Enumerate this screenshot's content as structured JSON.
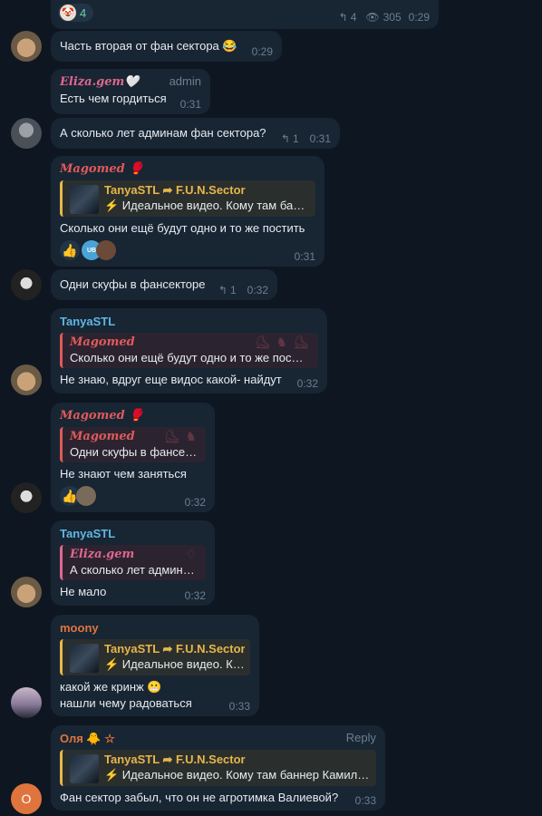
{
  "colors": {
    "background": "#0e1621",
    "bubble": "#182533",
    "eliza": "#e0678f",
    "magomed": "#e05a5a",
    "tanya": "#5fb7e3",
    "moony": "#e0743d",
    "olya": "#e0743d",
    "forward_name": "#e8b64a",
    "meta": "#6d7f8f"
  },
  "top_fragment": {
    "reaction_count": "4",
    "replies": "4",
    "views": "305",
    "time": "0:29"
  },
  "messages": [
    {
      "id": "m1",
      "text": "Часть вторая от фан сектора 😂",
      "time": "0:29"
    },
    {
      "id": "m2",
      "author": "Eliza.gem🤍",
      "role": "admin",
      "text": "Есть чем гордиться",
      "time": "0:31"
    },
    {
      "id": "m3",
      "text": "А сколько лет админам фан сектора?",
      "replies": "1",
      "time": "0:31"
    },
    {
      "id": "m4",
      "author": "Magomed 🥊",
      "fwd_name": "TanyaSTL ➦ F.U.N.Sector",
      "fwd_text": "⚡ Идеальное видео. Кому там бан…",
      "text": "Сколько они ещё будут одно и то же постить",
      "reactions": [
        "👍",
        "UB",
        "🤎"
      ],
      "time": "0:31"
    },
    {
      "id": "m5",
      "text": "Одни скуфы в фансекторе",
      "replies": "1",
      "time": "0:32"
    },
    {
      "id": "m6",
      "author": "TanyaSTL",
      "quote_name": "Magomed",
      "quote_text": "Сколько они ещё будут одно и то же пос…",
      "text": "Не знаю, вдруг еще видос какой- найдут",
      "time": "0:32"
    },
    {
      "id": "m7",
      "author": "Magomed 🥊",
      "quote_name": "Magomed",
      "quote_text": "Одни скуфы в фансек…",
      "text": "Не знают чем заняться",
      "reactions": [
        "👍",
        "🤎"
      ],
      "time": "0:32"
    },
    {
      "id": "m8",
      "author": "TanyaSTL",
      "quote_name": "Eliza.gem",
      "quote_text": "А сколько лет админа…",
      "text": "Не мало",
      "time": "0:32"
    },
    {
      "id": "m9",
      "author": "moony",
      "fwd_name": "TanyaSTL ➦ F.U.N.Sector",
      "fwd_text": "⚡ Идеальное видео. К…",
      "text": "какой же кринж 😬",
      "text2": "нашли чему радоваться",
      "time": "0:33"
    },
    {
      "id": "m10",
      "author": "Оля 🐥 ☆",
      "action": "Reply",
      "fwd_name": "TanyaSTL ➦ F.U.N.Sector",
      "fwd_text": "⚡ Идеальное видео. Кому там баннер Камил…",
      "text": "Фан сектор забыл, что он не агротимка Валиевой?",
      "time": "0:33",
      "avatar_letter": "О"
    }
  ]
}
